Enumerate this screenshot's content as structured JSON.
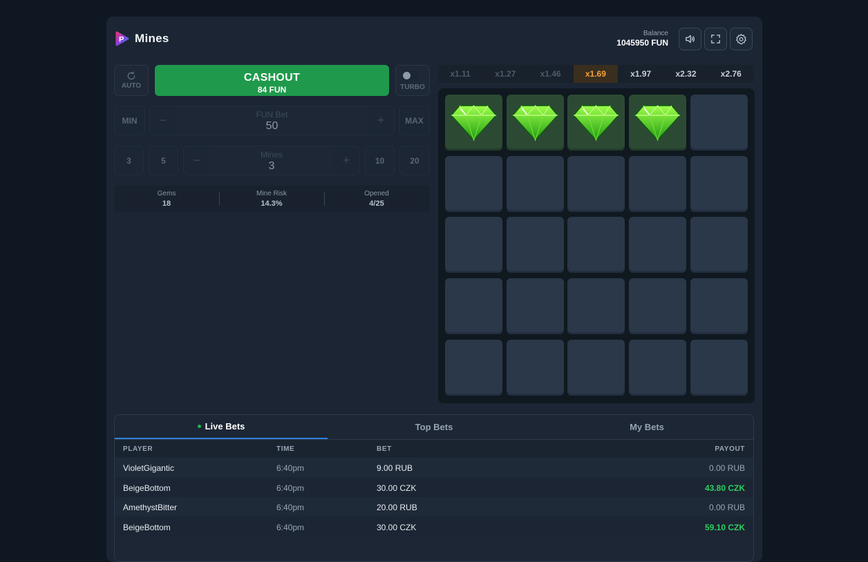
{
  "header": {
    "title": "Mines",
    "balance_label": "Balance",
    "balance_value": "1045950 FUN",
    "icons": [
      "sound-icon",
      "fullscreen-icon",
      "settings-icon"
    ]
  },
  "controls": {
    "auto_label": "AUTO",
    "cashout_label": "CASHOUT",
    "cashout_amount": "84 FUN",
    "turbo_label": "TURBO",
    "bet": {
      "min_label": "MIN",
      "max_label": "MAX",
      "field_label": "FUN Bet",
      "value": "50",
      "minus": "−",
      "plus": "+"
    },
    "mines": {
      "presets_left": [
        "3",
        "5"
      ],
      "presets_right": [
        "10",
        "20"
      ],
      "field_label": "Mines",
      "value": "3",
      "minus": "−",
      "plus": "+"
    }
  },
  "stats": [
    {
      "label": "Gems",
      "value": "18"
    },
    {
      "label": "Mine Risk",
      "value": "14.3%"
    },
    {
      "label": "Opened",
      "value": "4/25"
    }
  ],
  "multipliers": [
    {
      "label": "x1.11",
      "state": "past"
    },
    {
      "label": "x1.27",
      "state": "past"
    },
    {
      "label": "x1.46",
      "state": "past"
    },
    {
      "label": "x1.69",
      "state": "current"
    },
    {
      "label": "x1.97",
      "state": "next"
    },
    {
      "label": "x2.32",
      "state": "next"
    },
    {
      "label": "x2.76",
      "state": "next"
    }
  ],
  "grid": {
    "rows": 5,
    "cols": 5,
    "revealed_gems": [
      0,
      1,
      2,
      3
    ]
  },
  "bets": {
    "tabs": [
      "Live Bets",
      "Top Bets",
      "My Bets"
    ],
    "active_tab": 0,
    "columns": [
      "PLAYER",
      "TIME",
      "BET",
      "PAYOUT"
    ],
    "rows": [
      {
        "player": "VioletGigantic",
        "time": "6:40pm",
        "bet": "9.00 RUB",
        "payout": "0.00 RUB",
        "win": false
      },
      {
        "player": "BeigeBottom",
        "time": "6:40pm",
        "bet": "30.00 CZK",
        "payout": "43.80 CZK",
        "win": true
      },
      {
        "player": "AmethystBitter",
        "time": "6:40pm",
        "bet": "20.00 RUB",
        "payout": "0.00 RUB",
        "win": false
      },
      {
        "player": "BeigeBottom",
        "time": "6:40pm",
        "bet": "30.00 CZK",
        "payout": "59.10 CZK",
        "win": true
      }
    ]
  },
  "colors": {
    "cashout": "#1f9a4c",
    "current_multiplier": "#f2a33a",
    "win": "#2ecf5f",
    "active_tab": "#2f7fe0"
  }
}
